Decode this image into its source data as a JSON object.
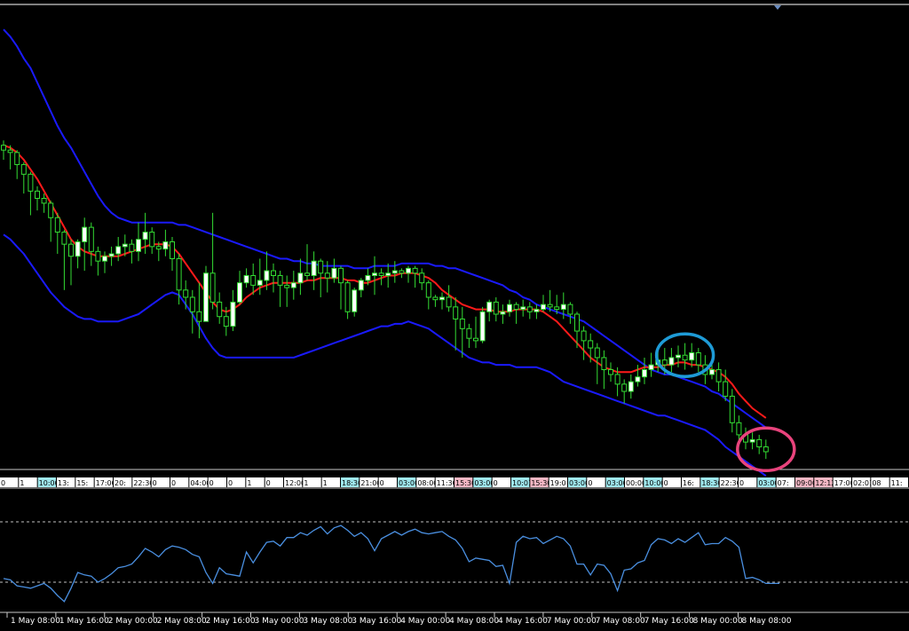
{
  "chart_data": [
    {
      "type": "candlestick",
      "panel": "price",
      "indicators": [
        "bollinger-bands",
        "moving-average"
      ],
      "colors": {
        "background": "#000000",
        "candle": "#33dd33",
        "candle_body_up": "#ffffff",
        "bands": "#1a1aff",
        "middle": "#ff1a1a",
        "highlight_blue": "#1e9bd7",
        "highlight_pink": "#e8437c",
        "axis_text": "#ffffff"
      },
      "candles_ohlc": [
        [
          0.72,
          0.7,
          0.74,
          0.66
        ],
        [
          0.7,
          0.69,
          0.72,
          0.62
        ],
        [
          0.69,
          0.64,
          0.7,
          0.58
        ],
        [
          0.64,
          0.6,
          0.65,
          0.52
        ],
        [
          0.6,
          0.53,
          0.61,
          0.43
        ],
        [
          0.53,
          0.5,
          0.55,
          0.45
        ],
        [
          0.5,
          0.48,
          0.52,
          0.44
        ],
        [
          0.48,
          0.42,
          0.49,
          0.32
        ],
        [
          0.42,
          0.36,
          0.44,
          0.27
        ],
        [
          0.36,
          0.31,
          0.37,
          0.12
        ],
        [
          0.31,
          0.26,
          0.33,
          0.14
        ],
        [
          0.26,
          0.32,
          0.33,
          0.21
        ],
        [
          0.32,
          0.38,
          0.42,
          0.2
        ],
        [
          0.38,
          0.28,
          0.4,
          0.22
        ],
        [
          0.28,
          0.24,
          0.3,
          0.18
        ],
        [
          0.24,
          0.26,
          0.28,
          0.19
        ],
        [
          0.26,
          0.27,
          0.3,
          0.22
        ],
        [
          0.27,
          0.3,
          0.34,
          0.24
        ],
        [
          0.3,
          0.31,
          0.35,
          0.26
        ],
        [
          0.31,
          0.28,
          0.33,
          0.23
        ],
        [
          0.28,
          0.33,
          0.4,
          0.24
        ],
        [
          0.33,
          0.36,
          0.44,
          0.27
        ],
        [
          0.36,
          0.3,
          0.38,
          0.27
        ],
        [
          0.3,
          0.29,
          0.32,
          0.24
        ],
        [
          0.29,
          0.32,
          0.37,
          0.26
        ],
        [
          0.32,
          0.25,
          0.34,
          0.2
        ],
        [
          0.25,
          0.12,
          0.27,
          0.06
        ],
        [
          0.12,
          0.09,
          0.16,
          0.04
        ],
        [
          0.09,
          0.03,
          0.12,
          -0.06
        ],
        [
          0.03,
          -0.01,
          0.15,
          -0.08
        ],
        [
          -0.01,
          0.19,
          0.22,
          0.0
        ],
        [
          0.19,
          0.07,
          0.44,
          0.04
        ],
        [
          0.07,
          0.01,
          0.11,
          -0.02
        ],
        [
          0.01,
          -0.03,
          0.05,
          -0.07
        ],
        [
          -0.03,
          0.07,
          0.12,
          -0.05
        ],
        [
          0.07,
          0.15,
          0.2,
          0.06
        ],
        [
          0.15,
          0.18,
          0.21,
          0.13
        ],
        [
          0.18,
          0.14,
          0.23,
          0.1
        ],
        [
          0.14,
          0.16,
          0.25,
          0.1
        ],
        [
          0.16,
          0.2,
          0.28,
          0.12
        ],
        [
          0.2,
          0.18,
          0.23,
          0.11
        ],
        [
          0.18,
          0.14,
          0.2,
          0.05
        ],
        [
          0.14,
          0.13,
          0.18,
          0.05
        ],
        [
          0.13,
          0.15,
          0.2,
          0.08
        ],
        [
          0.15,
          0.19,
          0.25,
          0.1
        ],
        [
          0.19,
          0.18,
          0.31,
          0.16
        ],
        [
          0.18,
          0.24,
          0.28,
          0.12
        ],
        [
          0.24,
          0.19,
          0.25,
          0.09
        ],
        [
          0.19,
          0.17,
          0.24,
          0.11
        ],
        [
          0.17,
          0.21,
          0.25,
          0.15
        ],
        [
          0.21,
          0.15,
          0.22,
          0.04
        ],
        [
          0.15,
          0.03,
          0.16,
          0.0
        ],
        [
          0.03,
          0.12,
          0.13,
          0.01
        ],
        [
          0.12,
          0.16,
          0.17,
          0.09
        ],
        [
          0.16,
          0.18,
          0.21,
          0.14
        ],
        [
          0.18,
          0.19,
          0.26,
          0.1
        ],
        [
          0.19,
          0.18,
          0.21,
          0.14
        ],
        [
          0.18,
          0.19,
          0.23,
          0.13
        ],
        [
          0.19,
          0.2,
          0.24,
          0.15
        ],
        [
          0.2,
          0.19,
          0.21,
          0.17
        ],
        [
          0.19,
          0.21,
          0.22,
          0.15
        ],
        [
          0.21,
          0.19,
          0.22,
          0.13
        ],
        [
          0.19,
          0.15,
          0.21,
          0.12
        ],
        [
          0.15,
          0.09,
          0.16,
          0.04
        ],
        [
          0.09,
          0.08,
          0.1,
          0.05
        ],
        [
          0.08,
          0.09,
          0.11,
          0.04
        ],
        [
          0.09,
          0.05,
          0.14,
          0.03
        ],
        [
          0.05,
          0.0,
          0.09,
          -0.13
        ],
        [
          0.0,
          -0.04,
          0.05,
          -0.16
        ],
        [
          -0.04,
          -0.08,
          -0.02,
          -0.12
        ],
        [
          -0.08,
          -0.09,
          0.01,
          -0.12
        ],
        [
          -0.09,
          0.03,
          0.05,
          -0.1
        ],
        [
          0.03,
          0.07,
          0.08,
          -0.01
        ],
        [
          0.07,
          0.02,
          0.09,
          -0.01
        ],
        [
          0.02,
          0.03,
          0.06,
          -0.02
        ],
        [
          0.03,
          0.06,
          0.08,
          0.01
        ],
        [
          0.06,
          0.04,
          0.07,
          -0.02
        ],
        [
          0.04,
          0.05,
          0.08,
          0.01
        ],
        [
          0.05,
          0.03,
          0.07,
          0.0
        ],
        [
          0.03,
          0.04,
          0.06,
          0.0
        ],
        [
          0.04,
          0.06,
          0.1,
          0.03
        ],
        [
          0.06,
          0.05,
          0.12,
          0.03
        ],
        [
          0.05,
          0.04,
          0.1,
          0.02
        ],
        [
          0.04,
          0.06,
          0.11,
          0.0
        ],
        [
          0.06,
          0.02,
          0.07,
          -0.02
        ],
        [
          0.02,
          -0.05,
          0.03,
          -0.12
        ],
        [
          -0.05,
          -0.09,
          -0.03,
          -0.17
        ],
        [
          -0.09,
          -0.12,
          -0.06,
          -0.18
        ],
        [
          -0.12,
          -0.16,
          -0.1,
          -0.27
        ],
        [
          -0.16,
          -0.21,
          -0.13,
          -0.29
        ],
        [
          -0.21,
          -0.23,
          -0.18,
          -0.26
        ],
        [
          -0.23,
          -0.27,
          -0.2,
          -0.32
        ],
        [
          -0.27,
          -0.3,
          -0.25,
          -0.35
        ],
        [
          -0.3,
          -0.26,
          -0.23,
          -0.33
        ],
        [
          -0.26,
          -0.24,
          -0.19,
          -0.28
        ],
        [
          -0.24,
          -0.21,
          -0.16,
          -0.27
        ],
        [
          -0.21,
          -0.19,
          -0.14,
          -0.24
        ],
        [
          -0.19,
          -0.17,
          -0.13,
          -0.22
        ],
        [
          -0.17,
          -0.19,
          -0.12,
          -0.23
        ],
        [
          -0.19,
          -0.16,
          -0.12,
          -0.22
        ],
        [
          -0.16,
          -0.15,
          -0.11,
          -0.2
        ],
        [
          -0.15,
          -0.17,
          -0.1,
          -0.21
        ],
        [
          -0.17,
          -0.14,
          -0.1,
          -0.2
        ],
        [
          -0.14,
          -0.19,
          -0.12,
          -0.22
        ],
        [
          -0.19,
          -0.23,
          -0.15,
          -0.27
        ],
        [
          -0.23,
          -0.21,
          -0.17,
          -0.25
        ],
        [
          -0.21,
          -0.26,
          -0.18,
          -0.3
        ],
        [
          -0.26,
          -0.32,
          -0.21,
          -0.34
        ],
        [
          -0.32,
          -0.43,
          -0.29,
          -0.47
        ],
        [
          -0.43,
          -0.48,
          -0.4,
          -0.52
        ],
        [
          -0.48,
          -0.51,
          -0.45,
          -0.54
        ],
        [
          -0.51,
          -0.5,
          -0.47,
          -0.54
        ],
        [
          -0.5,
          -0.53,
          -0.48,
          -0.56
        ],
        [
          -0.53,
          -0.55,
          -0.5,
          -0.58
        ]
      ],
      "upper_band": [
        1.2,
        1.17,
        1.13,
        1.08,
        1.04,
        0.98,
        0.92,
        0.86,
        0.8,
        0.75,
        0.71,
        0.66,
        0.61,
        0.56,
        0.51,
        0.47,
        0.44,
        0.42,
        0.41,
        0.4,
        0.4,
        0.4,
        0.4,
        0.4,
        0.4,
        0.4,
        0.39,
        0.39,
        0.38,
        0.37,
        0.36,
        0.35,
        0.34,
        0.33,
        0.32,
        0.31,
        0.3,
        0.29,
        0.28,
        0.27,
        0.26,
        0.25,
        0.25,
        0.24,
        0.24,
        0.23,
        0.23,
        0.22,
        0.22,
        0.22,
        0.22,
        0.22,
        0.21,
        0.21,
        0.21,
        0.22,
        0.22,
        0.22,
        0.22,
        0.23,
        0.23,
        0.23,
        0.23,
        0.23,
        0.22,
        0.22,
        0.21,
        0.21,
        0.2,
        0.19,
        0.18,
        0.17,
        0.16,
        0.15,
        0.14,
        0.12,
        0.11,
        0.09,
        0.08,
        0.06,
        0.05,
        0.04,
        0.03,
        0.02,
        0.01,
        0.0,
        -0.01,
        -0.03,
        -0.05,
        -0.07,
        -0.09,
        -0.11,
        -0.13,
        -0.15,
        -0.17,
        -0.19,
        -0.21,
        -0.22,
        -0.23,
        -0.23,
        -0.24,
        -0.25,
        -0.26,
        -0.27,
        -0.28,
        -0.3,
        -0.31,
        -0.33,
        -0.35,
        -0.37,
        -0.39,
        -0.41,
        -0.43,
        -0.45
      ],
      "middle_band": [
        0.72,
        0.71,
        0.69,
        0.66,
        0.62,
        0.58,
        0.53,
        0.48,
        0.43,
        0.38,
        0.33,
        0.3,
        0.28,
        0.27,
        0.26,
        0.26,
        0.26,
        0.26,
        0.27,
        0.28,
        0.29,
        0.3,
        0.31,
        0.31,
        0.31,
        0.3,
        0.27,
        0.23,
        0.19,
        0.15,
        0.11,
        0.07,
        0.04,
        0.03,
        0.04,
        0.06,
        0.09,
        0.11,
        0.13,
        0.14,
        0.15,
        0.15,
        0.15,
        0.15,
        0.15,
        0.16,
        0.16,
        0.17,
        0.17,
        0.17,
        0.17,
        0.16,
        0.16,
        0.15,
        0.15,
        0.16,
        0.17,
        0.18,
        0.18,
        0.19,
        0.19,
        0.19,
        0.18,
        0.17,
        0.15,
        0.12,
        0.1,
        0.08,
        0.06,
        0.05,
        0.04,
        0.04,
        0.04,
        0.03,
        0.03,
        0.03,
        0.04,
        0.04,
        0.04,
        0.04,
        0.03,
        0.01,
        -0.01,
        -0.04,
        -0.07,
        -0.1,
        -0.13,
        -0.16,
        -0.18,
        -0.2,
        -0.21,
        -0.22,
        -0.22,
        -0.22,
        -0.21,
        -0.2,
        -0.2,
        -0.2,
        -0.19,
        -0.19,
        -0.18,
        -0.18,
        -0.19,
        -0.19,
        -0.2,
        -0.21,
        -0.22,
        -0.24,
        -0.27,
        -0.31,
        -0.34,
        -0.37,
        -0.39,
        -0.41
      ],
      "lower_band": [
        0.35,
        0.33,
        0.3,
        0.27,
        0.23,
        0.19,
        0.15,
        0.11,
        0.08,
        0.05,
        0.03,
        0.01,
        0.0,
        0.0,
        -0.01,
        -0.01,
        -0.01,
        -0.01,
        0.0,
        0.01,
        0.02,
        0.04,
        0.06,
        0.08,
        0.1,
        0.11,
        0.1,
        0.06,
        0.02,
        -0.03,
        -0.08,
        -0.12,
        -0.15,
        -0.16,
        -0.16,
        -0.16,
        -0.16,
        -0.16,
        -0.16,
        -0.16,
        -0.16,
        -0.16,
        -0.16,
        -0.16,
        -0.15,
        -0.14,
        -0.13,
        -0.12,
        -0.11,
        -0.1,
        -0.09,
        -0.08,
        -0.07,
        -0.06,
        -0.05,
        -0.04,
        -0.03,
        -0.03,
        -0.02,
        -0.02,
        -0.01,
        -0.02,
        -0.03,
        -0.04,
        -0.06,
        -0.08,
        -0.1,
        -0.12,
        -0.14,
        -0.16,
        -0.17,
        -0.18,
        -0.18,
        -0.19,
        -0.19,
        -0.19,
        -0.2,
        -0.2,
        -0.2,
        -0.2,
        -0.21,
        -0.22,
        -0.24,
        -0.26,
        -0.27,
        -0.28,
        -0.29,
        -0.3,
        -0.31,
        -0.32,
        -0.33,
        -0.34,
        -0.35,
        -0.36,
        -0.37,
        -0.38,
        -0.39,
        -0.4,
        -0.4,
        -0.41,
        -0.42,
        -0.43,
        -0.44,
        -0.45,
        -0.46,
        -0.48,
        -0.5,
        -0.53,
        -0.55,
        -0.57,
        -0.59,
        -0.61,
        -0.63,
        -0.65
      ],
      "marked_zones": [
        {
          "name": "highlight-circle-blue",
          "candle_index": 101,
          "y": -0.15,
          "color": "#1e9bd7"
        },
        {
          "name": "highlight-circle-pink",
          "candle_index": 113,
          "y": -0.54,
          "color": "#e8437c"
        }
      ],
      "session_labels": [
        "0",
        "1",
        "10:00",
        "13:",
        "15:",
        "17:00",
        "20:",
        "22:30",
        "0",
        "0",
        "04:00",
        "0",
        "0",
        "1",
        "0",
        "12:00",
        "1",
        "1",
        "18:30",
        "21:00",
        "0",
        "03:00",
        "08:00",
        "11:30",
        "15:30",
        "03:00",
        "0",
        "10:01",
        "15:30",
        "19:0",
        "03:00",
        "0",
        "03:00",
        "00:00",
        "10:00",
        "0",
        "16:",
        "18:30",
        "22:30",
        "0",
        "03:00",
        "07:",
        "09:00",
        "12:12",
        "17:00",
        "02:01",
        "08",
        "11:"
      ]
    },
    {
      "type": "line",
      "panel": "oscillator",
      "indicator": "oscillator",
      "color": "#4a8fe0",
      "reference_levels": [
        0.75,
        0.25
      ],
      "y_range": [
        0,
        1
      ],
      "values": [
        0.28,
        0.27,
        0.22,
        0.21,
        0.2,
        0.22,
        0.24,
        0.2,
        0.14,
        0.09,
        0.2,
        0.33,
        0.31,
        0.3,
        0.25,
        0.28,
        0.32,
        0.37,
        0.38,
        0.4,
        0.46,
        0.53,
        0.5,
        0.46,
        0.52,
        0.55,
        0.54,
        0.52,
        0.48,
        0.46,
        0.33,
        0.24,
        0.37,
        0.32,
        0.31,
        0.3,
        0.5,
        0.41,
        0.5,
        0.58,
        0.59,
        0.55,
        0.62,
        0.62,
        0.66,
        0.64,
        0.68,
        0.71,
        0.65,
        0.7,
        0.72,
        0.68,
        0.63,
        0.66,
        0.61,
        0.51,
        0.61,
        0.64,
        0.67,
        0.64,
        0.67,
        0.69,
        0.66,
        0.65,
        0.66,
        0.67,
        0.63,
        0.6,
        0.53,
        0.42,
        0.45,
        0.44,
        0.43,
        0.38,
        0.39,
        0.24,
        0.58,
        0.63,
        0.61,
        0.62,
        0.57,
        0.6,
        0.63,
        0.61,
        0.55,
        0.4,
        0.4,
        0.31,
        0.4,
        0.39,
        0.32,
        0.18,
        0.35,
        0.36,
        0.41,
        0.43,
        0.56,
        0.61,
        0.6,
        0.57,
        0.61,
        0.58,
        0.62,
        0.66,
        0.56,
        0.57,
        0.57,
        0.62,
        0.59,
        0.54,
        0.28,
        0.29,
        0.27,
        0.24,
        0.24,
        0.24
      ],
      "x_tick_labels": [
        "1 May 08:00",
        "1 May 16:00",
        "2 May 00:00",
        "2 May 08:00",
        "2 May 16:00",
        "3 May 00:00",
        "3 May 08:00",
        "3 May 16:00",
        "4 May 00:00",
        "4 May 08:00",
        "4 May 16:00",
        "7 May 00:00",
        "7 May 08:00",
        "7 May 16:00",
        "8 May 00:00",
        "8 May 08:00"
      ]
    }
  ]
}
